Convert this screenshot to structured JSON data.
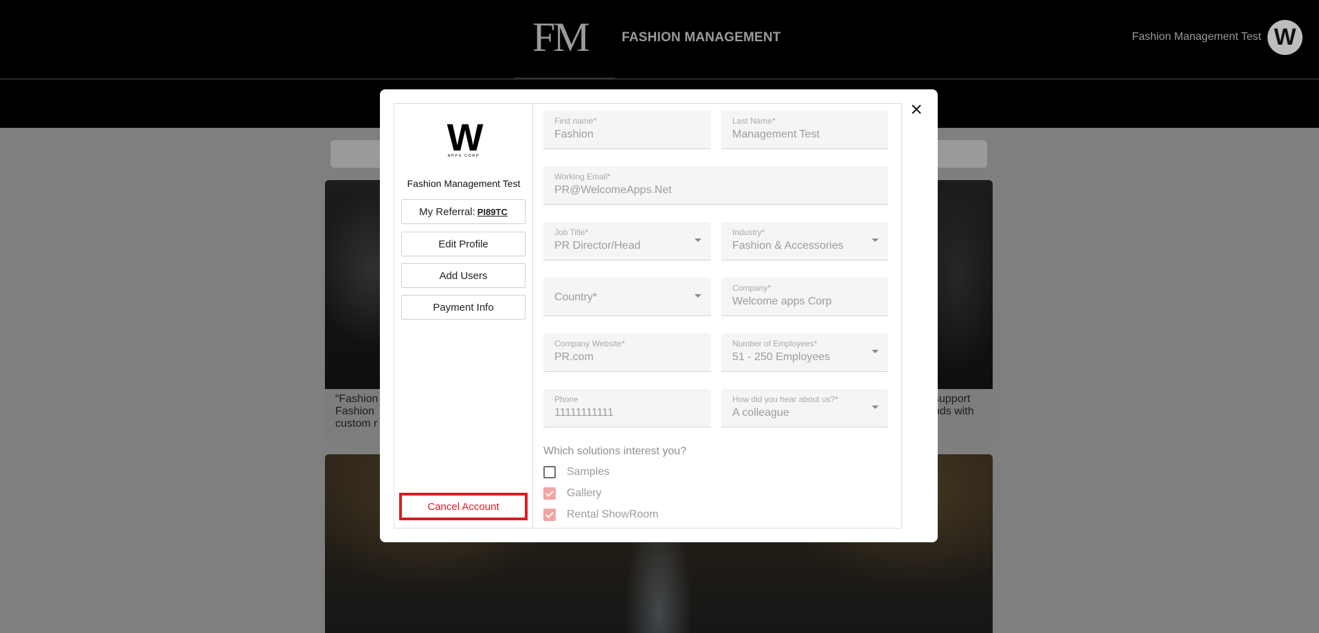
{
  "header": {
    "logo": "FM",
    "title": "FASHION MANAGEMENT",
    "user_name": "Fashion Management Test",
    "avatar_initial": "W"
  },
  "background": {
    "card1_text_left": "“Fashion Fashion custom r",
    "card1_text_right": "support nds with"
  },
  "modal": {
    "company_logo": "W",
    "company_logo_sub": "APPS CORP",
    "profile_name": "Fashion Management Test",
    "referral_label": "My Referral:",
    "referral_code": "PI89TC",
    "buttons": {
      "edit_profile": "Edit Profile",
      "add_users": "Add Users",
      "payment_info": "Payment Info",
      "cancel_account": "Cancel Account"
    },
    "fields": {
      "first_name": {
        "label": "First name*",
        "value": "Fashion"
      },
      "last_name": {
        "label": "Last Name*",
        "value": "Management Test"
      },
      "working_email": {
        "label": "Working Email*",
        "value": "PR@WelcomeApps.Net"
      },
      "job_title": {
        "label": "Job Title*",
        "value": "PR Director/Head"
      },
      "industry": {
        "label": "Industry*",
        "value": "Fashion & Accessories"
      },
      "country": {
        "placeholder": "Country*"
      },
      "company": {
        "label": "Company*",
        "value": "Welcome apps Corp"
      },
      "company_website": {
        "label": "Company Website*",
        "value": "PR.com"
      },
      "employees": {
        "label": "Number of Employees*",
        "value": "51 - 250 Employees"
      },
      "phone": {
        "label": "Phone",
        "value": "11111111111"
      },
      "hear_about": {
        "label": "How did you hear about us?*",
        "value": "A colleague"
      }
    },
    "solutions": {
      "title": "Which solutions interest you?",
      "options": [
        {
          "label": "Samples",
          "checked": false
        },
        {
          "label": "Gallery",
          "checked": true
        },
        {
          "label": "Rental ShowRoom",
          "checked": true
        }
      ]
    }
  },
  "colors": {
    "cancel_red": "#e0191f",
    "checkbox_checked": "#f3a3a3",
    "overlay": "#7f7f7f"
  }
}
